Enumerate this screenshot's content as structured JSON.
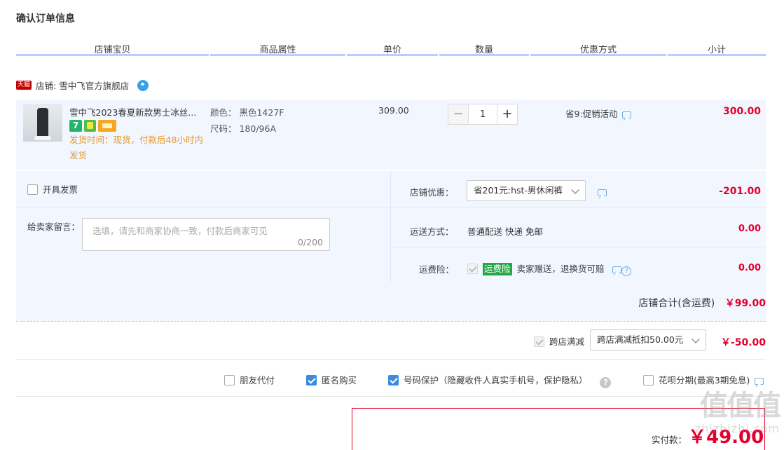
{
  "page_title": "确认订单信息",
  "columns": [
    "店铺宝贝",
    "商品属性",
    "单价",
    "数量",
    "优惠方式",
    "小计"
  ],
  "shop": {
    "badge": "天猫",
    "name": "店铺: 雪中飞官方旗舰店"
  },
  "item": {
    "name": "雪中飞2023春夏新款男士冰丝...",
    "badge_7": "7",
    "ship_time": "发货时间：现货，付款后48小时内发货",
    "attr_color": "颜色：  黑色1427F",
    "attr_size": "尺码：  180/96A",
    "price": "309.00",
    "qty": "1",
    "minus": "−",
    "plus": "+",
    "promo": "省9:促销活动",
    "subtotal": "300.00"
  },
  "options": {
    "invoice_label": "开具发票",
    "message_label": "给卖家留言：",
    "message_placeholder": "选填，请先和商家协商一致，付款后商家可见",
    "message_count": "0/200",
    "shop_discount_label": "店铺优惠：",
    "shop_discount_value": "省201元:hst-男休闲裤",
    "shop_discount_amount": "-201.00",
    "shipping_label": "运送方式：",
    "shipping_value": "普通配送 快递 免邮",
    "shipping_amount": "0.00",
    "insurance_label": "运费险：",
    "insurance_badge": "运费险",
    "insurance_text": "卖家赠送，退换货可赔",
    "insurance_amount": "0.00",
    "help_mark": "?"
  },
  "shop_total": {
    "label": "店铺合计(含运费)",
    "amount": "￥99.00"
  },
  "cross_store": {
    "label": "跨店满减",
    "select_value": "跨店满减抵扣50.00元",
    "amount": "￥-50.00"
  },
  "flags": {
    "friend_pay": "朋友代付",
    "anonymous": "匿名购买",
    "number_protect": "号码保护（隐藏收件人真实手机号，保护隐私）",
    "help_mark": "?",
    "huabei": "花呗分期(最高3期免息)"
  },
  "payment": {
    "label": "实付款：",
    "amount": "￥49.00"
  },
  "watermark": {
    "big": "值值值",
    "small": "zhizhizhi.com"
  },
  "colors": {
    "accent_red": "#e4002b",
    "light_blue_bg": "#f2f7ff",
    "header_underline": "#b2d1ff",
    "checkbox_blue": "#3b8be0",
    "ship_time_orange": "#e5962c"
  }
}
